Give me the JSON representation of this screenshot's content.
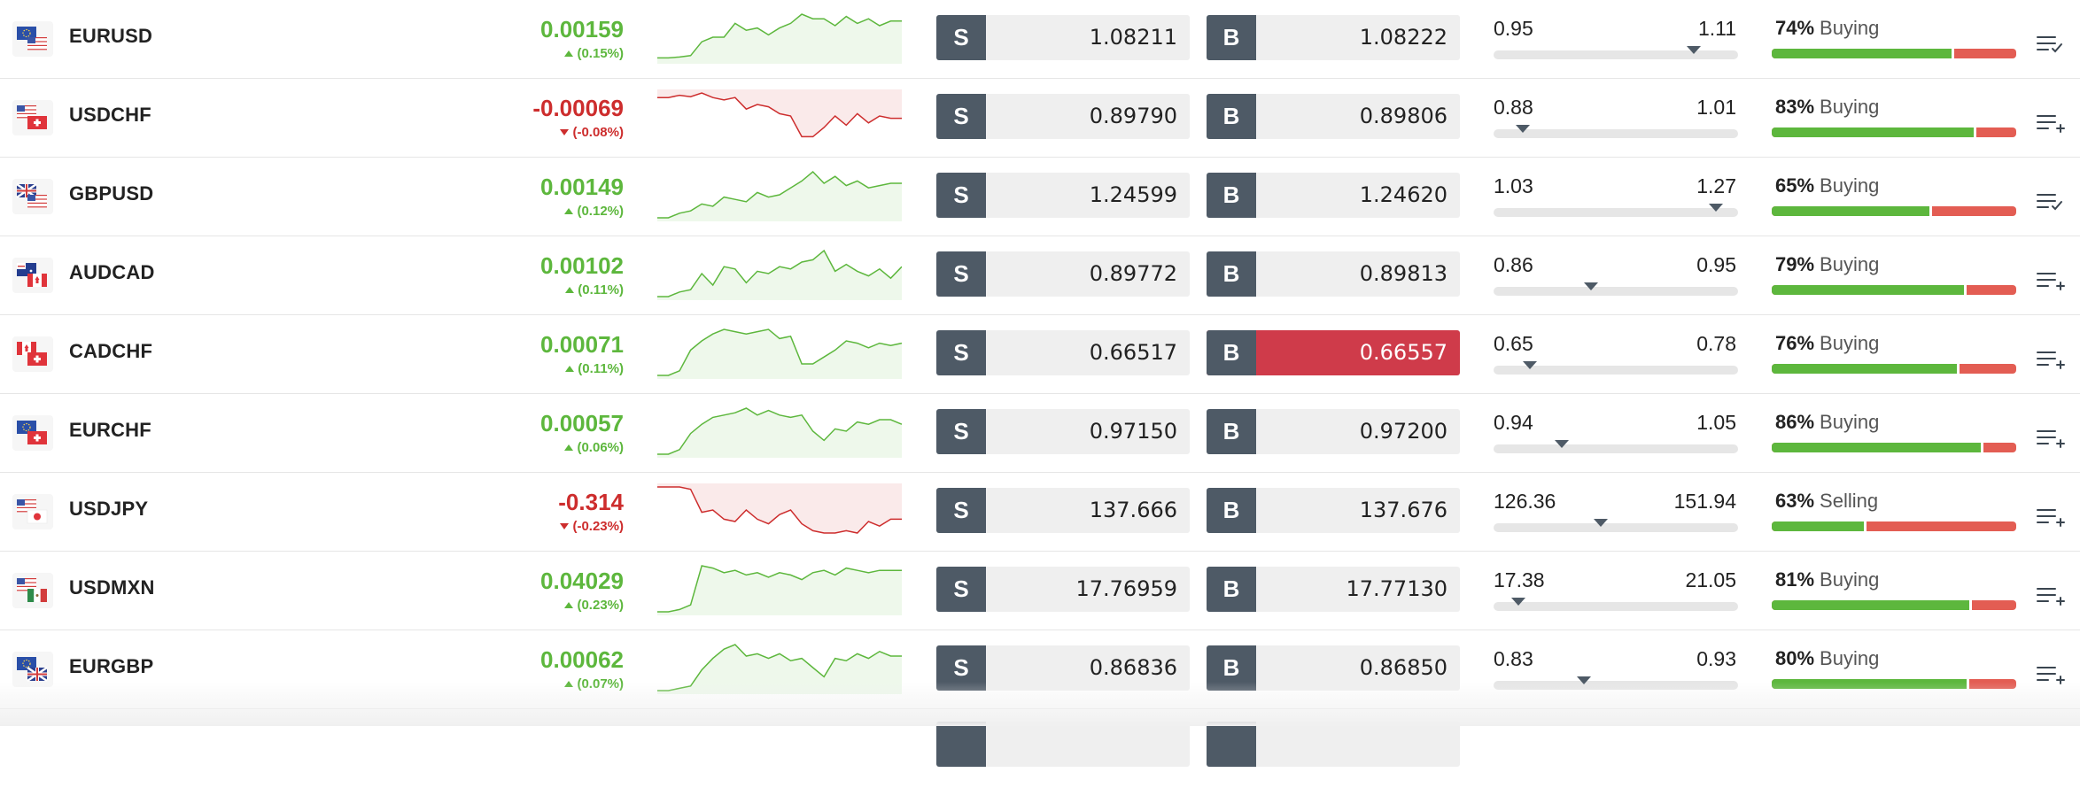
{
  "colors": {
    "positive": "#5db73d",
    "negative": "#cd2d2d",
    "button_label_bg": "#4e5a66",
    "button_bg": "#efefef",
    "button_highlight": "#cf3b4a",
    "buying_bar": "#5db73d",
    "selling_bar": "#e35d53"
  },
  "instruments": [
    {
      "symbol": "EURUSD",
      "flag": "eu-us-flag-icon",
      "change": "0.00159",
      "change_pct": "(0.15%)",
      "direction": "up",
      "spark": [
        0.95,
        0.95,
        0.93,
        0.9,
        0.6,
        0.5,
        0.5,
        0.2,
        0.35,
        0.3,
        0.45,
        0.3,
        0.2,
        0.0,
        0.1,
        0.1,
        0.25,
        0.05,
        0.2,
        0.1,
        0.25,
        0.15,
        0.15
      ],
      "sell_label": "S",
      "sell_price": "1.08211",
      "buy_label": "B",
      "buy_price": "1.08222",
      "range_low": "0.95",
      "range_high": "1.11",
      "range_pos": 0.82,
      "sentiment_pct": "74%",
      "sentiment_dir": "Buying",
      "sentiment_value": 0.74,
      "watch": "watchlist-added-icon"
    },
    {
      "symbol": "USDCHF",
      "flag": "us-ch-flag-icon",
      "change": "-0.00069",
      "change_pct": "(-0.08%)",
      "direction": "down",
      "spark": [
        0.1,
        0.1,
        0.05,
        0.08,
        0.0,
        0.1,
        0.15,
        0.1,
        0.35,
        0.25,
        0.3,
        0.45,
        0.5,
        0.95,
        0.95,
        0.75,
        0.5,
        0.7,
        0.45,
        0.65,
        0.5,
        0.55,
        0.55
      ],
      "sell_label": "S",
      "sell_price": "0.89790",
      "buy_label": "B",
      "buy_price": "0.89806",
      "range_low": "0.88",
      "range_high": "1.01",
      "range_pos": 0.12,
      "sentiment_pct": "83%",
      "sentiment_dir": "Buying",
      "sentiment_value": 0.83,
      "watch": "watchlist-add-icon"
    },
    {
      "symbol": "GBPUSD",
      "flag": "gb-us-flag-icon",
      "change": "0.00149",
      "change_pct": "(0.12%)",
      "direction": "up",
      "spark": [
        1.0,
        1.0,
        0.9,
        0.85,
        0.7,
        0.75,
        0.55,
        0.6,
        0.65,
        0.45,
        0.55,
        0.5,
        0.35,
        0.2,
        0.0,
        0.25,
        0.1,
        0.3,
        0.2,
        0.35,
        0.3,
        0.25,
        0.25
      ],
      "sell_label": "S",
      "sell_price": "1.24599",
      "buy_label": "B",
      "buy_price": "1.24620",
      "range_low": "1.03",
      "range_high": "1.27",
      "range_pos": 0.91,
      "sentiment_pct": "65%",
      "sentiment_dir": "Buying",
      "sentiment_value": 0.65,
      "watch": "watchlist-added-icon"
    },
    {
      "symbol": "AUDCAD",
      "flag": "au-ca-flag-icon",
      "change": "0.00102",
      "change_pct": "(0.11%)",
      "direction": "up",
      "spark": [
        1.0,
        1.0,
        0.9,
        0.85,
        0.5,
        0.75,
        0.35,
        0.4,
        0.7,
        0.45,
        0.5,
        0.35,
        0.4,
        0.25,
        0.2,
        0.0,
        0.45,
        0.3,
        0.45,
        0.55,
        0.4,
        0.6,
        0.35
      ],
      "sell_label": "S",
      "sell_price": "0.89772",
      "buy_label": "B",
      "buy_price": "0.89813",
      "range_low": "0.86",
      "range_high": "0.95",
      "range_pos": 0.4,
      "sentiment_pct": "79%",
      "sentiment_dir": "Buying",
      "sentiment_value": 0.79,
      "watch": "watchlist-add-icon"
    },
    {
      "symbol": "CADCHF",
      "flag": "ca-ch-flag-icon",
      "change": "0.00071",
      "change_pct": "(0.11%)",
      "direction": "up",
      "spark": [
        1.0,
        1.0,
        0.9,
        0.45,
        0.25,
        0.1,
        0.0,
        0.05,
        0.1,
        0.05,
        0.0,
        0.2,
        0.15,
        0.75,
        0.75,
        0.6,
        0.45,
        0.25,
        0.3,
        0.4,
        0.3,
        0.35,
        0.3
      ],
      "sell_label": "S",
      "sell_price": "0.66517",
      "buy_label": "B",
      "buy_price": "0.66557",
      "buy_highlight": true,
      "range_low": "0.65",
      "range_high": "0.78",
      "range_pos": 0.15,
      "sentiment_pct": "76%",
      "sentiment_dir": "Buying",
      "sentiment_value": 0.76,
      "watch": "watchlist-add-icon"
    },
    {
      "symbol": "EURCHF",
      "flag": "eu-ch-flag-icon",
      "change": "0.00057",
      "change_pct": "(0.06%)",
      "direction": "up",
      "spark": [
        1.0,
        1.0,
        0.9,
        0.55,
        0.35,
        0.2,
        0.15,
        0.1,
        0.0,
        0.15,
        0.05,
        0.15,
        0.2,
        0.15,
        0.5,
        0.7,
        0.45,
        0.5,
        0.3,
        0.35,
        0.25,
        0.25,
        0.35
      ],
      "sell_label": "S",
      "sell_price": "0.97150",
      "buy_label": "B",
      "buy_price": "0.97200",
      "range_low": "0.94",
      "range_high": "1.05",
      "range_pos": 0.28,
      "sentiment_pct": "86%",
      "sentiment_dir": "Buying",
      "sentiment_value": 0.86,
      "watch": "watchlist-add-icon"
    },
    {
      "symbol": "USDJPY",
      "flag": "us-jp-flag-icon",
      "change": "-0.314",
      "change_pct": "(-0.23%)",
      "direction": "down",
      "spark": [
        0.0,
        0.0,
        0.0,
        0.05,
        0.55,
        0.5,
        0.7,
        0.75,
        0.5,
        0.7,
        0.8,
        0.6,
        0.5,
        0.8,
        0.95,
        1.0,
        1.0,
        0.95,
        1.0,
        0.75,
        0.85,
        0.7,
        0.7
      ],
      "sell_label": "S",
      "sell_price": "137.666",
      "buy_label": "B",
      "buy_price": "137.676",
      "range_low": "126.36",
      "range_high": "151.94",
      "range_pos": 0.44,
      "sentiment_pct": "63%",
      "sentiment_dir": "Selling",
      "sentiment_value": 0.38,
      "watch": "watchlist-add-icon"
    },
    {
      "symbol": "USDMXN",
      "flag": "us-mx-flag-icon",
      "change": "0.04029",
      "change_pct": "(0.23%)",
      "direction": "up",
      "spark": [
        1.0,
        1.0,
        0.95,
        0.85,
        0.0,
        0.05,
        0.15,
        0.1,
        0.2,
        0.15,
        0.25,
        0.15,
        0.2,
        0.3,
        0.15,
        0.1,
        0.2,
        0.05,
        0.1,
        0.15,
        0.1,
        0.1,
        0.1
      ],
      "sell_label": "S",
      "sell_price": "17.76959",
      "buy_label": "B",
      "buy_price": "17.77130",
      "range_low": "17.38",
      "range_high": "21.05",
      "range_pos": 0.1,
      "sentiment_pct": "81%",
      "sentiment_dir": "Buying",
      "sentiment_value": 0.81,
      "watch": "watchlist-add-icon"
    },
    {
      "symbol": "EURGBP",
      "flag": "eu-gb-flag-icon",
      "change": "0.00062",
      "change_pct": "(0.07%)",
      "direction": "up",
      "spark": [
        1.0,
        1.0,
        0.95,
        0.9,
        0.55,
        0.3,
        0.1,
        0.0,
        0.25,
        0.2,
        0.3,
        0.2,
        0.35,
        0.3,
        0.5,
        0.7,
        0.3,
        0.35,
        0.2,
        0.3,
        0.15,
        0.25,
        0.25
      ],
      "sell_label": "S",
      "sell_price": "0.86836",
      "buy_label": "B",
      "buy_price": "0.86850",
      "range_low": "0.83",
      "range_high": "0.93",
      "range_pos": 0.37,
      "sentiment_pct": "80%",
      "sentiment_dir": "Buying",
      "sentiment_value": 0.8,
      "watch": "watchlist-add-icon"
    }
  ]
}
